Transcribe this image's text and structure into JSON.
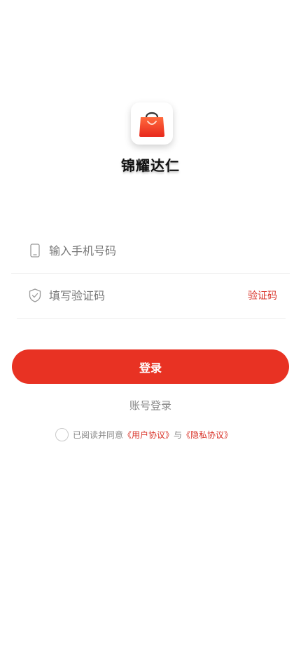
{
  "app": {
    "name": "锦耀达仁",
    "logo_icon": "shopping-bag-icon"
  },
  "form": {
    "phone_placeholder": "输入手机号码",
    "code_placeholder": "填写验证码",
    "get_code_label": "验证码",
    "phone_icon": "phone-icon",
    "code_icon": "shield-check-icon"
  },
  "actions": {
    "login_label": "登录",
    "account_login_label": "账号登录"
  },
  "agreement": {
    "prefix": "已阅读并同意",
    "user_agreement": "《用户协议》",
    "conjunction": "与",
    "privacy_policy": "《隐私协议》",
    "checked": false
  },
  "colors": {
    "brand": "#e83223",
    "link": "#d9342a"
  }
}
